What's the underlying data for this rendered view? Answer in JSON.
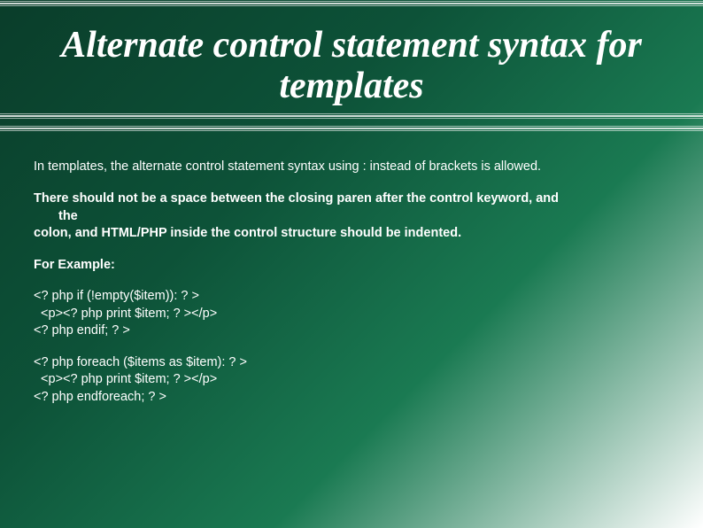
{
  "title": "Alternate control statement syntax for templates",
  "body": {
    "p1": "In templates, the alternate control statement syntax using : instead of brackets is allowed.",
    "p2_l1": "There should not be a space between the closing paren after the control keyword, and",
    "p2_l2": "the",
    "p2_l3": "colon, and HTML/PHP inside the control structure should be indented.",
    "example_label": "For Example:",
    "code1_l1": "<? php if (!empty($item)): ? >",
    "code1_l2": "  <p><? php print $item; ? ></p>",
    "code1_l3": "<? php endif; ? >",
    "code2_l1": "<? php foreach ($items as $item): ? >",
    "code2_l2": "  <p><? php print $item; ? ></p>",
    "code2_l3": "<? php endforeach; ? >"
  }
}
